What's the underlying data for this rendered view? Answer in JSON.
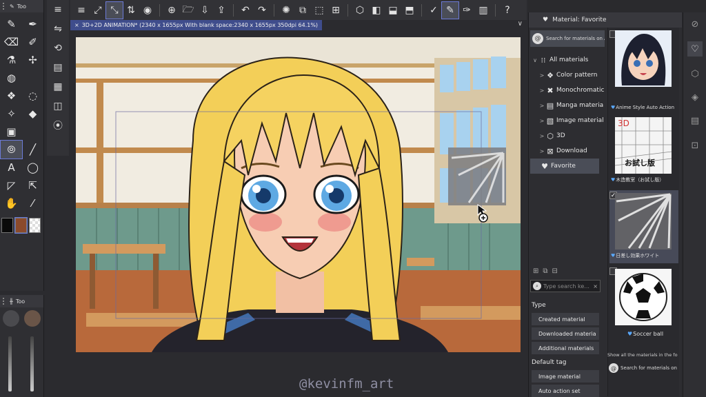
{
  "tool_panel": {
    "title": "Too",
    "tools": [
      {
        "name": "pen-icon",
        "glyph": "✎"
      },
      {
        "name": "marker-icon",
        "glyph": "✒"
      },
      {
        "name": "eraser-icon",
        "glyph": "⌫"
      },
      {
        "name": "dropper-pen-icon",
        "glyph": "✐"
      },
      {
        "name": "airbrush-icon",
        "glyph": "⚗"
      },
      {
        "name": "sparkle-icon",
        "glyph": "✢"
      },
      {
        "name": "globe-icon",
        "glyph": "◍"
      },
      {
        "name": "blank",
        "glyph": ""
      },
      {
        "name": "fill-icon",
        "glyph": "❖"
      },
      {
        "name": "lasso-icon",
        "glyph": "◌"
      },
      {
        "name": "magic-wand-icon",
        "glyph": "✧"
      },
      {
        "name": "bucket-icon",
        "glyph": "◆"
      },
      {
        "name": "gradient-icon",
        "glyph": "▣"
      },
      {
        "name": "blank2",
        "glyph": ""
      },
      {
        "name": "lasso-select-icon",
        "glyph": "⦾"
      },
      {
        "name": "line-icon",
        "glyph": "╱"
      },
      {
        "name": "text-icon",
        "glyph": "A"
      },
      {
        "name": "balloon-icon",
        "glyph": "◯"
      },
      {
        "name": "frame-icon",
        "glyph": "◸"
      },
      {
        "name": "operation-icon",
        "glyph": "⇱"
      },
      {
        "name": "hand-icon",
        "glyph": "✋"
      },
      {
        "name": "eyedropper-icon",
        "glyph": "⁄"
      }
    ]
  },
  "tool_property": {
    "title": "Too"
  },
  "sub_tools": [
    "≡",
    "⇋",
    "⟲",
    "▤",
    "▦",
    "◫",
    "⦿"
  ],
  "command_bar": {
    "buttons": [
      "≡",
      "⤢",
      "⤡",
      "⇅",
      "◉",
      "⊕",
      "🗁",
      "⇩",
      "⇪",
      "↶",
      "↷",
      "✺",
      "⧉",
      "⬚",
      "⊞",
      "⬡",
      "◧",
      "⬓",
      "⬒",
      "✓",
      "✎",
      "✑",
      "▥",
      "?"
    ]
  },
  "document_tab": {
    "title": "3D+2D ANIMATION* (2340 x 1655px With blank space:2340 x 1655px 350dpi 64.1%)"
  },
  "watermark": "@kevinfm_art",
  "material_panel": {
    "title": "Material: Favorite",
    "search_label": "Search for materials on A",
    "tree": [
      {
        "label": "All materials",
        "icon": "⁝⁝",
        "level": 0,
        "chevron": "∨"
      },
      {
        "label": "Color pattern",
        "icon": "❖",
        "level": 1,
        "chevron": ">"
      },
      {
        "label": "Monochromatic",
        "icon": "✖",
        "level": 1,
        "chevron": ">"
      },
      {
        "label": "Manga materia",
        "icon": "▤",
        "level": 1,
        "chevron": ">"
      },
      {
        "label": "Image material",
        "icon": "▧",
        "level": 1,
        "chevron": ">"
      },
      {
        "label": "3D",
        "icon": "⬡",
        "level": 1,
        "chevron": ">"
      },
      {
        "label": "Download",
        "icon": "⊠",
        "level": 1,
        "chevron": ">"
      },
      {
        "label": "Favorite",
        "icon": "♥",
        "level": 0,
        "chevron": ""
      }
    ],
    "materials": [
      {
        "label": "Anime Style Auto Action",
        "checked": false,
        "selected": false
      },
      {
        "label": "木造教室（お試し版）",
        "checked": false,
        "selected": false,
        "thumb_text_top": "3D",
        "thumb_text_bottom": "お試し版"
      },
      {
        "label": "日差し効果ホワイト",
        "checked": true,
        "selected": true
      },
      {
        "label": "Soccer ball",
        "checked": false,
        "selected": false
      }
    ],
    "hint": "Show all the materials in the fo",
    "search_bottom": "Search for materials on",
    "tag_search_placeholder": "Type search ke...",
    "type_title": "Type",
    "type_buttons": [
      "Created material",
      "Downloaded materia",
      "Additional materials"
    ],
    "default_tag_title": "Default tag",
    "tag_buttons": [
      "Image material",
      "Auto action set"
    ]
  },
  "colors": {
    "accent": "#6c7bd8",
    "tab_blue": "#3f4d8c",
    "favorite_heart": "#5aa9ff"
  }
}
